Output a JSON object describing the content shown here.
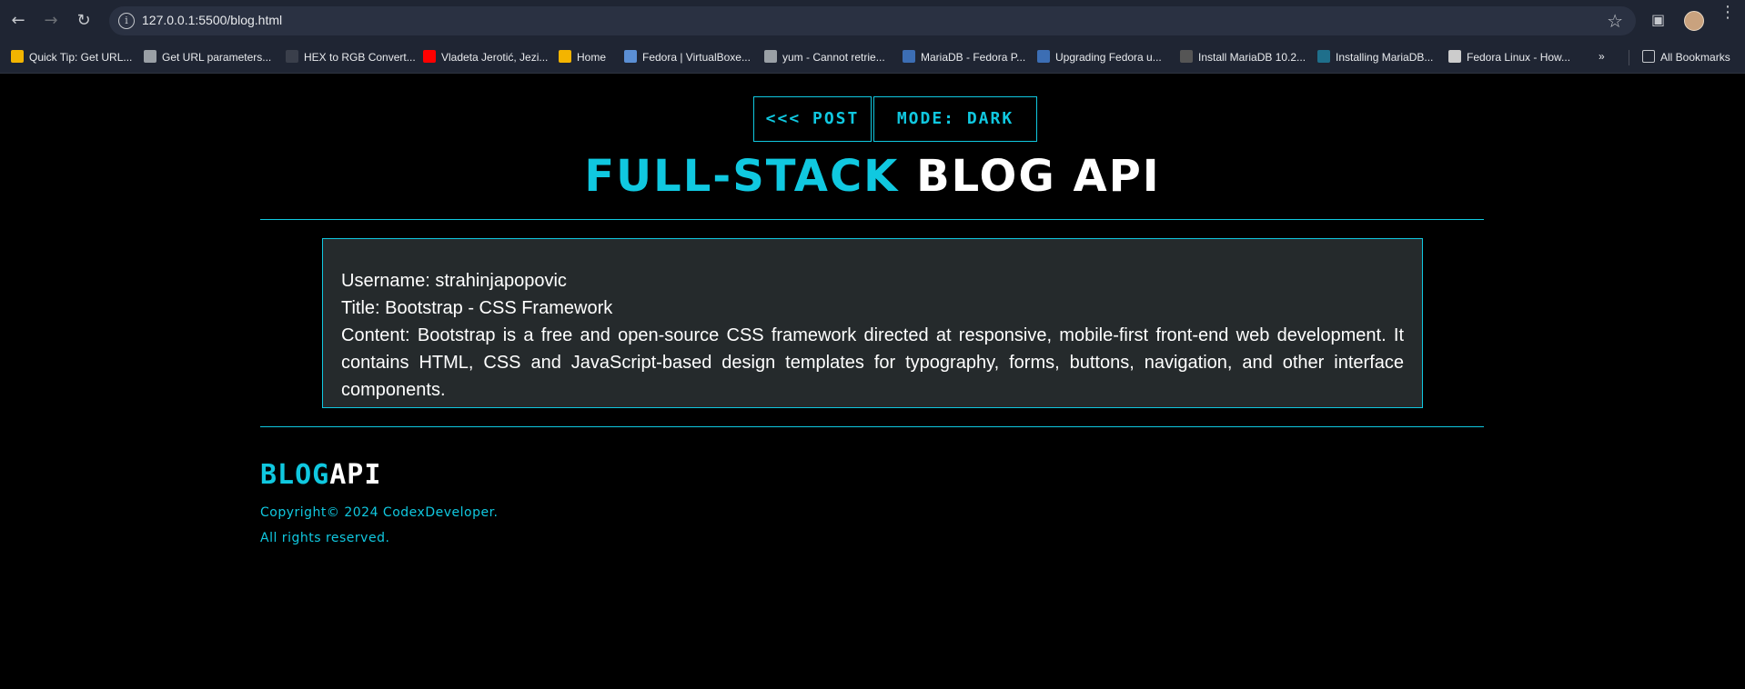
{
  "browser": {
    "url": "127.0.0.1:5500/blog.html",
    "bookmarks": [
      {
        "label": "Quick Tip: Get URL...",
        "icon": "bookmark-favicon",
        "color": "#f2b400"
      },
      {
        "label": "Get URL parameters...",
        "icon": "laptop-icon",
        "color": "#9aa0a6"
      },
      {
        "label": "HEX to RGB Convert...",
        "icon": "dot-icon",
        "color": "#3a3f4b"
      },
      {
        "label": "Vladeta Jerotić, Jezi...",
        "icon": "youtube-icon",
        "color": "#ff0000"
      },
      {
        "label": "Home",
        "icon": "flower-icon",
        "color": "#f4b400"
      },
      {
        "label": "Fedora | VirtualBoxe...",
        "icon": "virtualbox-icon",
        "color": "#5b8fd4"
      },
      {
        "label": "yum - Cannot retrie...",
        "icon": "stack-icon",
        "color": "#9aa0a6"
      },
      {
        "label": "MariaDB - Fedora P...",
        "icon": "fedora-icon",
        "color": "#3c6eb4"
      },
      {
        "label": "Upgrading Fedora u...",
        "icon": "fedora-icon",
        "color": "#3c6eb4"
      },
      {
        "label": "Install MariaDB 10.2...",
        "icon": "terminal-icon",
        "color": "#555555"
      },
      {
        "label": "Installing MariaDB...",
        "icon": "mariadb-icon",
        "color": "#1f6f8b"
      },
      {
        "label": "Fedora Linux - How...",
        "icon": "penguin-icon",
        "color": "#cccccc"
      }
    ],
    "all_bookmarks": "All Bookmarks"
  },
  "nav": {
    "post_button": "<<< POST",
    "mode_button": "MODE: DARK"
  },
  "header": {
    "title_accent": "FULL-STACK",
    "title_rest": "BLOG API"
  },
  "post": {
    "username": "Username: strahinjapopovic",
    "title": "Title: Bootstrap - CSS Framework",
    "content": "Content: Bootstrap is a free and open-source CSS framework directed at responsive, mobile-first front-end web development. It contains HTML, CSS and JavaScript-based design templates for typography, forms, buttons, navigation, and other interface components."
  },
  "footer": {
    "logo_accent": "BLOG",
    "logo_rest": "API",
    "copyright": "Copyright© 2024 CodexDeveloper.",
    "rights": "All rights reserved."
  },
  "colors": {
    "accent": "#10c8e0",
    "card_bg": "#252a2c",
    "page_bg": "#000000"
  }
}
